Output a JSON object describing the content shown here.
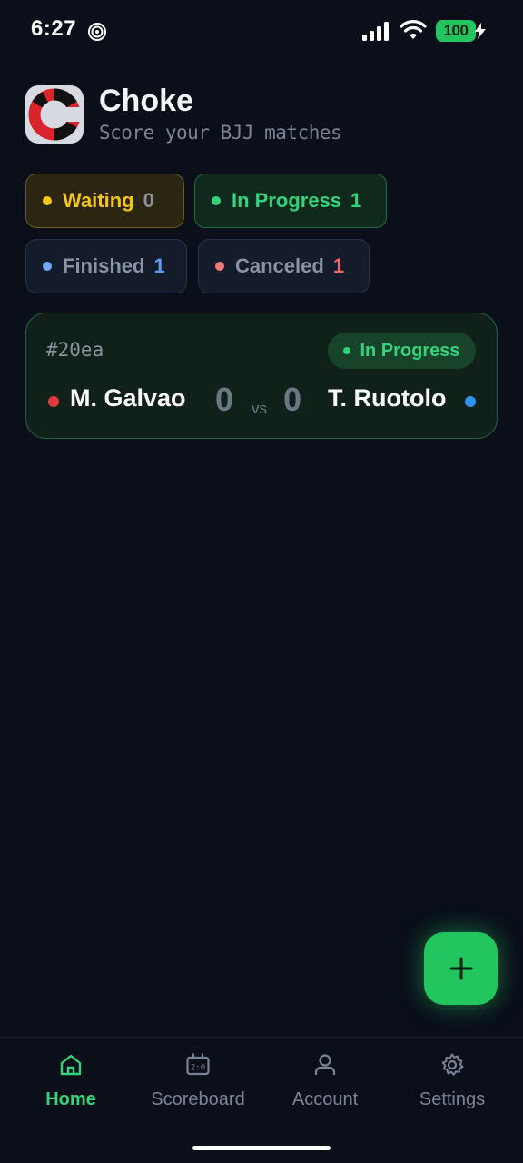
{
  "status_bar": {
    "time": "6:27",
    "battery": "100",
    "icons": [
      "focus-icon",
      "signal-icon",
      "wifi-icon",
      "battery-icon",
      "charging-bolt-icon"
    ]
  },
  "header": {
    "title": "Choke",
    "subtitle": "Score your BJJ matches",
    "logo_icon": "choke-logo-icon"
  },
  "filters": [
    {
      "label": "Waiting",
      "count": "0",
      "color": "#f5c518"
    },
    {
      "label": "In Progress",
      "count": "1",
      "color": "#34d27a"
    },
    {
      "label": "Finished",
      "count": "1",
      "color": "#5d9bf5"
    },
    {
      "label": "Canceled",
      "count": "1",
      "color": "#ef6b6b"
    }
  ],
  "matches": [
    {
      "id": "#20ea",
      "status": "In Progress",
      "left_player": {
        "name": "M. Galvao",
        "score": "0",
        "color": "#e03a3a"
      },
      "right_player": {
        "name": "T. Ruotolo",
        "score": "0",
        "color": "#2f93f3"
      },
      "vs": "vs"
    }
  ],
  "fab": {
    "icon": "plus-icon",
    "color": "#22c55e"
  },
  "nav": {
    "items": [
      {
        "label": "Home",
        "icon": "home-icon",
        "active": true
      },
      {
        "label": "Scoreboard",
        "icon": "scoreboard-icon",
        "active": false
      },
      {
        "label": "Account",
        "icon": "user-icon",
        "active": false
      },
      {
        "label": "Settings",
        "icon": "gear-icon",
        "active": false
      }
    ],
    "active_color": "#34d27a"
  }
}
